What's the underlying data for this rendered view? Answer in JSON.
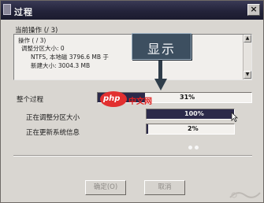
{
  "window": {
    "title": "过程",
    "close_glyph": "×"
  },
  "current_op": {
    "label": "当前操作 (/ 3)",
    "log_lines": [
      "操作 ( / 3)",
      "调整分区大小: 0",
      "NTFS, 本地磁   3796.6 MB 于",
      "新建大小: 3004.3 MB"
    ]
  },
  "callout": {
    "text": "显示"
  },
  "progress": {
    "overall": {
      "label": "整个过程",
      "value_text": "31%",
      "value": 0.31
    },
    "resize": {
      "label": "正在调整分区大小",
      "value_text": "100%",
      "value": 1.0
    },
    "update": {
      "label": "正在更新系统信息",
      "value_text": "2%",
      "value": 0.02
    }
  },
  "watermark": {
    "logo": "php",
    "text": "中文网"
  },
  "buttons": {
    "confirm": "确定(O)",
    "cancel": "取消"
  },
  "colors": {
    "titlebar": "#23233a",
    "progress_fill": "#2c2a4a",
    "callout_bg": "#3d4f60",
    "watermark_red": "#e23030"
  }
}
